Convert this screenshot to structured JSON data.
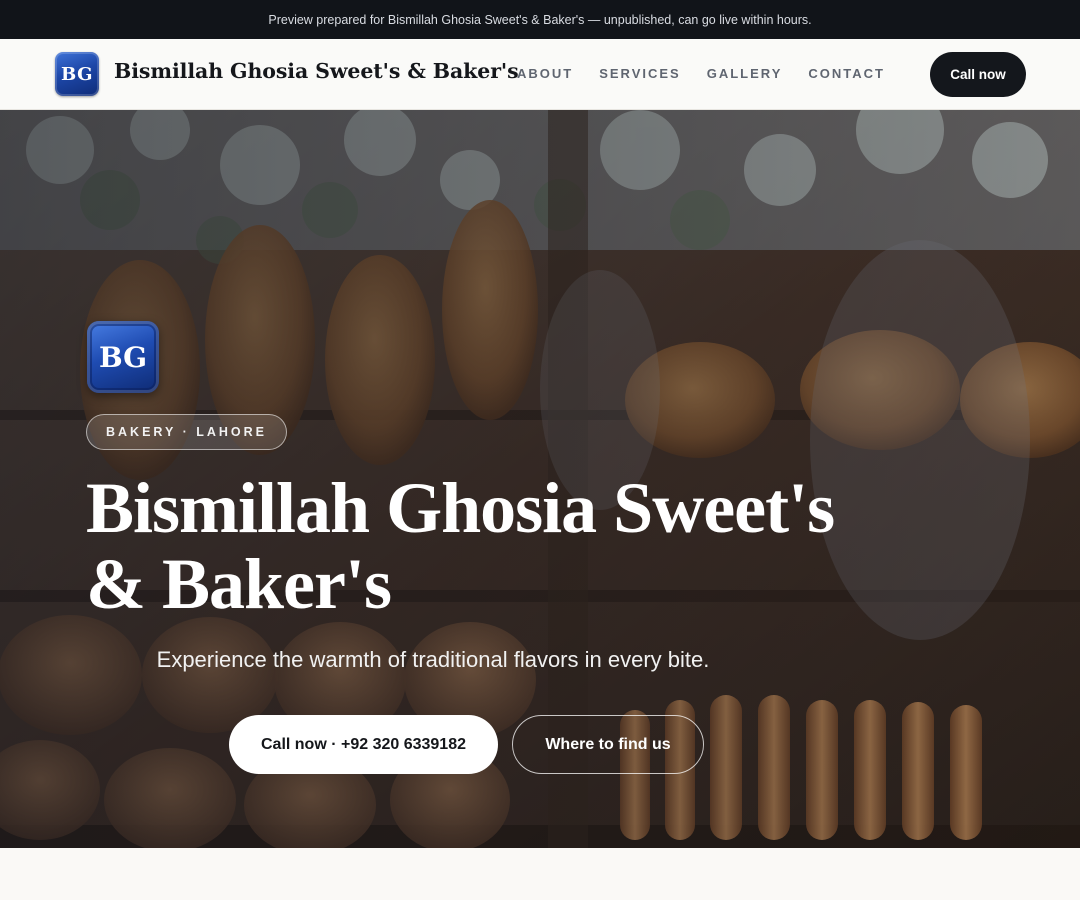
{
  "banner": {
    "text": "Preview prepared for Bismillah Ghosia Sweet's & Baker's — unpublished, can go live within hours."
  },
  "header": {
    "logo_text": "BG",
    "brand_name": "Bismillah Ghosia Sweet's & Baker's",
    "nav": [
      {
        "label": "ABOUT"
      },
      {
        "label": "SERVICES"
      },
      {
        "label": "GALLERY"
      },
      {
        "label": "CONTACT"
      }
    ],
    "call_button": "Call now"
  },
  "hero": {
    "logo_text": "BG",
    "pill": "BAKERY · LAHORE",
    "title": "Bismillah Ghosia Sweet's & Baker's",
    "subtitle": "Experience the warmth of traditional flavors in every bite.",
    "primary_button": "Call now · +92 320 6339182",
    "secondary_button": "Where to find us",
    "background_image": "bakery-window-bread-photo"
  },
  "colors": {
    "banner_bg": "#111419",
    "header_bg": "#fafaf8",
    "logo_blue": "#1d47a8",
    "dark_button": "#14171c",
    "page_bg": "#faf9f6"
  }
}
